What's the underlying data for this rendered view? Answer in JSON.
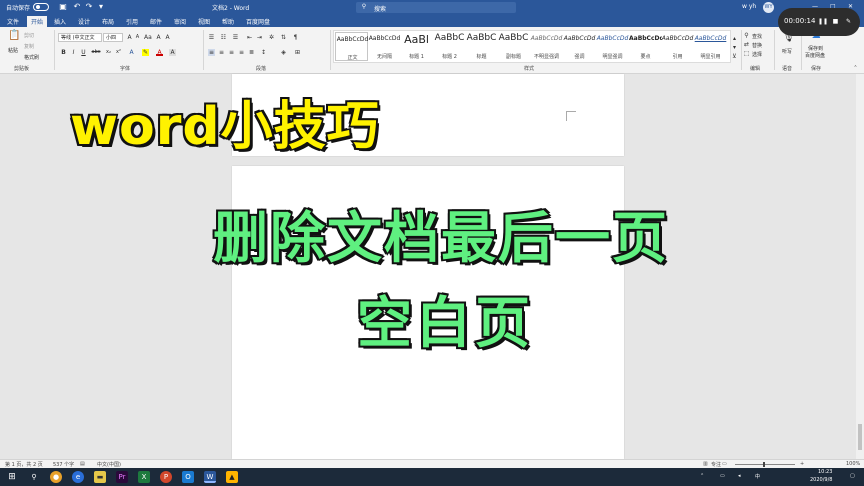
{
  "titlebar": {
    "autosave_label": "自动保存",
    "doc_title": "文档2 - Word",
    "search_placeholder": "搜索",
    "user_name": "w yh",
    "user_initials": "WY",
    "window_buttons": [
      "—",
      "□",
      "✕"
    ]
  },
  "menu": {
    "tabs": [
      "文件",
      "开始",
      "插入",
      "设计",
      "布局",
      "引用",
      "邮件",
      "审阅",
      "视图",
      "帮助",
      "百度网盘"
    ],
    "active": "开始"
  },
  "ribbon": {
    "clipboard": {
      "paste": "粘贴",
      "cut": "剪切",
      "copy": "复制",
      "format_painter": "格式刷",
      "label": "剪贴板"
    },
    "font": {
      "font_name": "等线 (中文正文",
      "font_size": "小四",
      "label": "字体",
      "glyphs": [
        "B",
        "I",
        "U",
        "abc",
        "x₂",
        "x²",
        "A",
        "A",
        "Aa",
        "A",
        "A"
      ]
    },
    "paragraph": {
      "label": "段落"
    },
    "styles": {
      "label": "样式",
      "items": [
        {
          "preview": "AaBbCcDd",
          "name": "正文"
        },
        {
          "preview": "AaBbCcDd",
          "name": "无间隔"
        },
        {
          "preview": "AaBl",
          "name": "标题 1"
        },
        {
          "preview": "AaBbC",
          "name": "标题 2"
        },
        {
          "preview": "AaBbC",
          "name": "标题"
        },
        {
          "preview": "AaBbC",
          "name": "副标题"
        },
        {
          "preview": "AaBbCcDd",
          "name": "不明显强调"
        },
        {
          "preview": "AaBbCcDd",
          "name": "强调"
        },
        {
          "preview": "AaBbCcDd",
          "name": "明显强调"
        },
        {
          "preview": "AaBbCcDd",
          "name": "要点"
        },
        {
          "preview": "AaBbCcDd",
          "name": "引用"
        },
        {
          "preview": "AaBbCcDd",
          "name": "明显引用"
        }
      ]
    },
    "editing": {
      "find": "查找",
      "replace": "替换",
      "select": "选择",
      "label": "编辑"
    },
    "voice": {
      "dictate": "听写",
      "label": "语音"
    },
    "save": {
      "save_to": "保存到",
      "baidu": "百度网盘",
      "label": "保存"
    }
  },
  "recorder": {
    "time": "00:00:14"
  },
  "captions": {
    "line1": "word小技巧",
    "line2": "删除文档最后一页",
    "line3": "空白页"
  },
  "statusbar": {
    "page": "第 1 页，共 2 页",
    "words": "537 个字",
    "language": "中文(中国)",
    "focus": "专注",
    "zoom": "100%"
  },
  "taskbar": {
    "time": "10:23",
    "date": "2020/9/8"
  },
  "colors": {
    "word_blue": "#2b579a",
    "caption_yellow": "#fff200",
    "caption_green": "#5ff080"
  }
}
